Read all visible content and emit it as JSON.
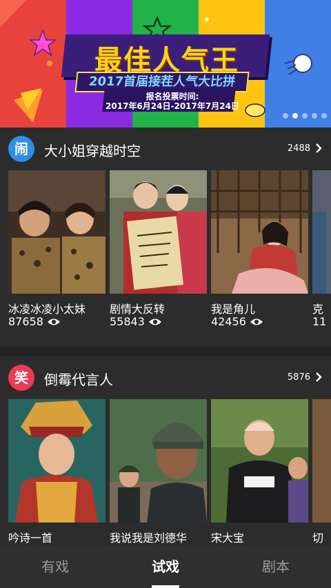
{
  "banner": {
    "title": "最佳人气王",
    "subtitle": "2017首届接茬人气大比拼",
    "vote_label": "报名投票时间:",
    "vote_dates": "2017年6月24日-2017年7月24日",
    "stripe_colors": [
      "#e8423c",
      "#8a2be2",
      "#21b24a",
      "#ffc412",
      "#3f7fe6"
    ],
    "slide_count": 5,
    "active_slide": 1
  },
  "sections": [
    {
      "badge": "闹",
      "badge_color": "#2f8fe8",
      "title": "大小姐穿越时空",
      "count": "2488",
      "cards": [
        {
          "name": "冰凌冰凌小太妹",
          "views": "87658"
        },
        {
          "name": "剧情大反转",
          "views": "55843"
        },
        {
          "name": "我是角儿",
          "views": "42456"
        },
        {
          "name": "克",
          "views": "11"
        }
      ]
    },
    {
      "badge": "笑",
      "badge_color": "#ec3b55",
      "title": "倒霉代言人",
      "count": "5876",
      "cards": [
        {
          "name": "吟诗一首"
        },
        {
          "name": "我说我是刘德华"
        },
        {
          "name": "宋大宝"
        },
        {
          "name": "切"
        }
      ]
    }
  ],
  "tabs": [
    {
      "label": "有戏",
      "active": false
    },
    {
      "label": "试戏",
      "active": true
    },
    {
      "label": "剧本",
      "active": false
    }
  ],
  "icons": {
    "eye": "eye-icon",
    "chevron": "chevron-right-icon"
  }
}
